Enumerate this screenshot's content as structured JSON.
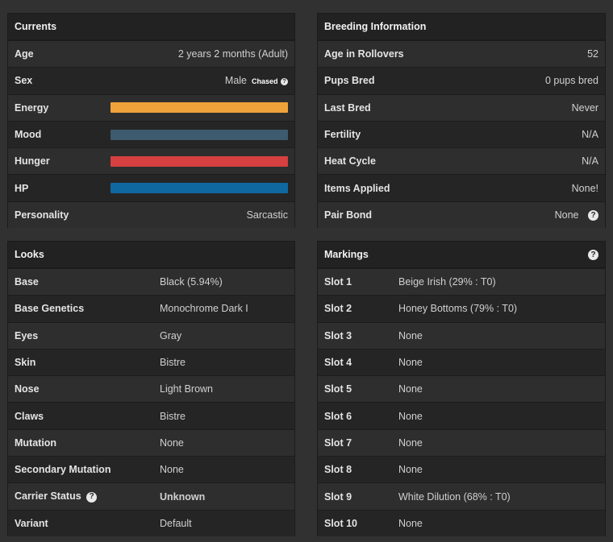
{
  "currents": {
    "title": "Currents",
    "age_label": "Age",
    "age_value": "2 years 2 months (Adult)",
    "sex_label": "Sex",
    "sex_value": "Male",
    "sex_badge": "Chased",
    "energy_label": "Energy",
    "mood_label": "Mood",
    "hunger_label": "Hunger",
    "hp_label": "HP",
    "personality_label": "Personality",
    "personality_value": "Sarcastic",
    "bar_colors": {
      "energy": "#f0a23a",
      "mood": "#3d5a6e",
      "hunger": "#d64040",
      "hp": "#1068a0"
    },
    "bar_levels": {
      "energy": 1.0,
      "mood": 1.0,
      "hunger": 1.0,
      "hp": 1.0
    }
  },
  "breeding": {
    "title": "Breeding Information",
    "rows": [
      {
        "label": "Age in Rollovers",
        "value": "52"
      },
      {
        "label": "Pups Bred",
        "value": "0 pups bred"
      },
      {
        "label": "Last Bred",
        "value": "Never"
      },
      {
        "label": "Fertility",
        "value": "N/A"
      },
      {
        "label": "Heat Cycle",
        "value": "N/A"
      },
      {
        "label": "Items Applied",
        "value": "None!"
      },
      {
        "label": "Pair Bond",
        "value": "None"
      }
    ]
  },
  "looks": {
    "title": "Looks",
    "rows": [
      {
        "label": "Base",
        "value": "Black (5.94%)"
      },
      {
        "label": "Base Genetics",
        "value": "Monochrome Dark I"
      },
      {
        "label": "Eyes",
        "value": "Gray"
      },
      {
        "label": "Skin",
        "value": "Bistre"
      },
      {
        "label": "Nose",
        "value": "Light Brown"
      },
      {
        "label": "Claws",
        "value": "Bistre"
      },
      {
        "label": "Mutation",
        "value": "None"
      },
      {
        "label": "Secondary Mutation",
        "value": "None"
      },
      {
        "label": "Carrier Status",
        "value": "Unknown"
      },
      {
        "label": "Variant",
        "value": "Default"
      }
    ]
  },
  "markings": {
    "title": "Markings",
    "rows": [
      {
        "label": "Slot 1",
        "value": "Beige Irish (29% : T0)"
      },
      {
        "label": "Slot 2",
        "value": "Honey Bottoms (79% : T0)"
      },
      {
        "label": "Slot 3",
        "value": "None"
      },
      {
        "label": "Slot 4",
        "value": "None"
      },
      {
        "label": "Slot 5",
        "value": "None"
      },
      {
        "label": "Slot 6",
        "value": "None"
      },
      {
        "label": "Slot 7",
        "value": "None"
      },
      {
        "label": "Slot 8",
        "value": "None"
      },
      {
        "label": "Slot 9",
        "value": "White Dilution (68% : T0)"
      },
      {
        "label": "Slot 10",
        "value": "None"
      }
    ]
  },
  "icons": {
    "help": "question-circle-icon"
  }
}
